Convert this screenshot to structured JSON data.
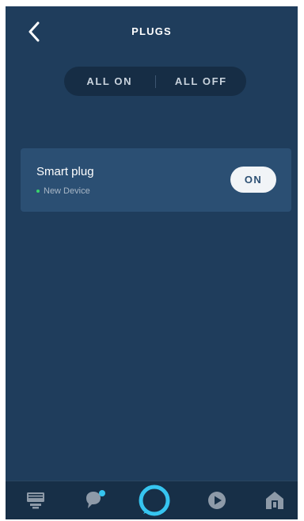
{
  "header": {
    "title": "PLUGS",
    "back_icon": "chevron-left-icon"
  },
  "controls": {
    "all_on_label": "ALL ON",
    "all_off_label": "ALL OFF"
  },
  "devices": [
    {
      "name": "Smart plug",
      "status": "New Device",
      "status_color": "#39d36b",
      "toggle_label": "ON"
    }
  ],
  "bottom_nav": {
    "items": [
      {
        "icon": "home-devices-icon"
      },
      {
        "icon": "communicate-icon",
        "badge_color": "#36c5f0"
      },
      {
        "icon": "alexa-icon",
        "color": "#36c5f0"
      },
      {
        "icon": "play-icon"
      },
      {
        "icon": "smart-home-icon"
      }
    ]
  },
  "colors": {
    "background": "#1f3d5c",
    "card": "#2b4f73",
    "accent": "#36c5f0"
  }
}
